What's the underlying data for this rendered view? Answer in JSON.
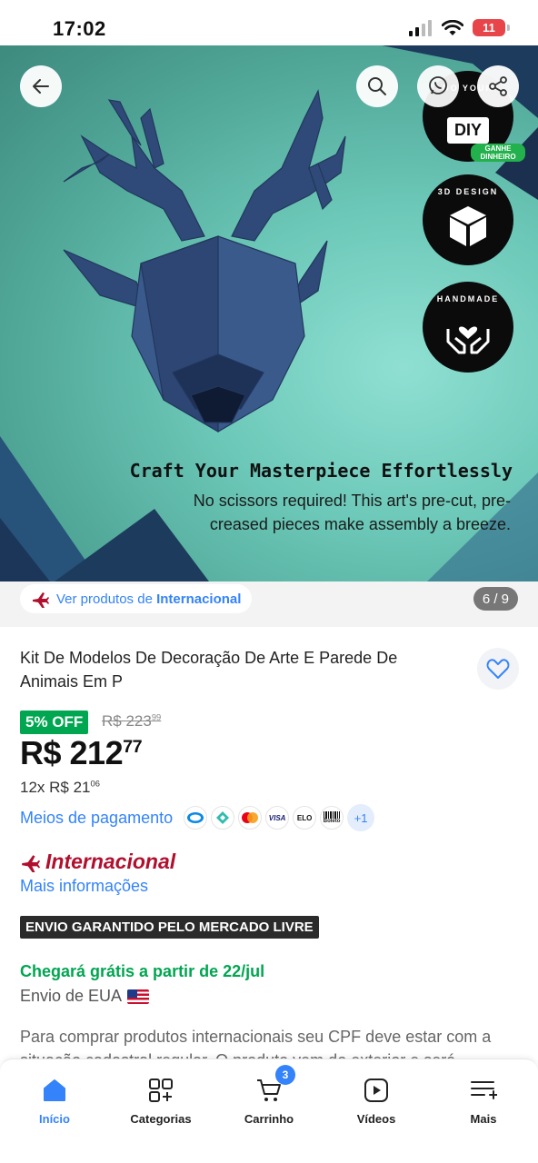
{
  "status_bar": {
    "time": "17:02",
    "battery": "11"
  },
  "hero": {
    "badges": [
      {
        "arc_text": "DO YOUR",
        "main_text": "DIY"
      },
      {
        "arc_text": "3D DESIGN",
        "main_text": ""
      },
      {
        "arc_text": "HANDMADE",
        "main_text": ""
      }
    ],
    "earn_badge": "GANHE DINHEIRO",
    "headline": "Craft Your Masterpiece Effortlessly",
    "subtext": "No scissors required! This art's pre-cut, pre-creased pieces make assembly a breeze."
  },
  "strip": {
    "intl_link_prefix": "Ver produtos de ",
    "intl_link_strong": "Internacional",
    "image_counter": "6 / 9"
  },
  "product": {
    "title": "Kit De Modelos De Decoração De Arte E Parede De Animais Em P",
    "discount_badge": "5% OFF",
    "old_price_main": "R$ 223",
    "old_price_cents": "99",
    "price_main": "R$ 212",
    "price_cents": "77",
    "installments_main": "12x R$ 21",
    "installments_cents": "06",
    "payment_label": "Meios de pagamento",
    "payment_methods": [
      "mercadopago",
      "pix",
      "mastercard",
      "VISA",
      "ELO",
      "Boleto"
    ],
    "payment_more": "+1",
    "intl_brand": "Internacional",
    "more_info": "Mais informações",
    "guarantee_badge": "ENVIO GARANTIDO PELO MERCADO LIVRE",
    "arrival": "Chegará grátis a partir de 22/jul",
    "ship_from": "Envio de EUA",
    "notice": "Para comprar produtos internacionais seu CPF deve estar com a situação cadastral regular. O produto vem do exterior e será"
  },
  "bottom_nav": {
    "items": [
      {
        "label": "Início",
        "icon": "home-icon",
        "active": true
      },
      {
        "label": "Categorias",
        "icon": "categories-icon",
        "active": false
      },
      {
        "label": "Carrinho",
        "icon": "cart-icon",
        "active": false,
        "badge": "3"
      },
      {
        "label": "Vídeos",
        "icon": "video-icon",
        "active": false
      },
      {
        "label": "Mais",
        "icon": "menu-icon",
        "active": false
      }
    ]
  },
  "colors": {
    "accent": "#3483fa",
    "discount": "#00a650",
    "intl": "#b0102e",
    "hero_bg": "#6cc8b8"
  }
}
